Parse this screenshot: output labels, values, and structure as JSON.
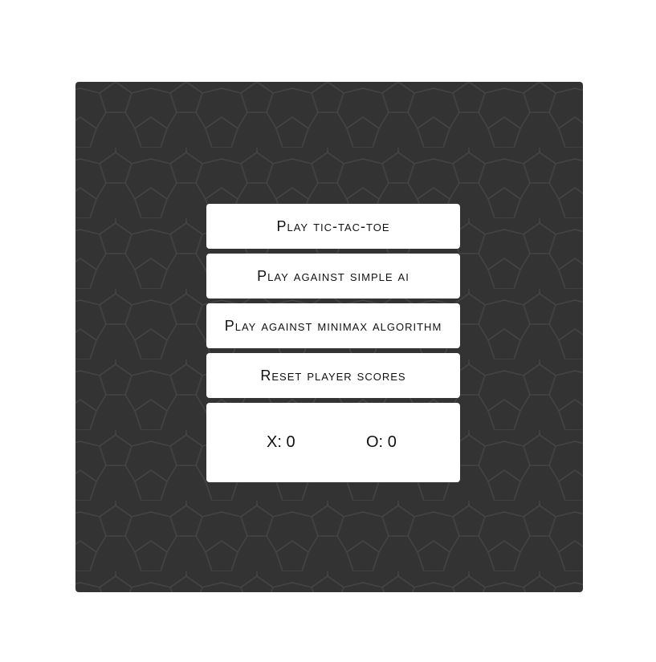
{
  "colors": {
    "page_background": "#ffffff",
    "board_background": "#333333",
    "pattern_stroke": "#444444",
    "panel_background": "#ffffff",
    "text": "#111111"
  },
  "menu": {
    "play_label": "Play tic-tac-toe",
    "simple_ai_label": "Play against simple ai",
    "minimax_label": "Play against minimax algorithm",
    "reset_label": "Reset player scores"
  },
  "scores": {
    "x_label": "X:",
    "x_value": "0",
    "o_label": "O:",
    "o_value": "0"
  }
}
